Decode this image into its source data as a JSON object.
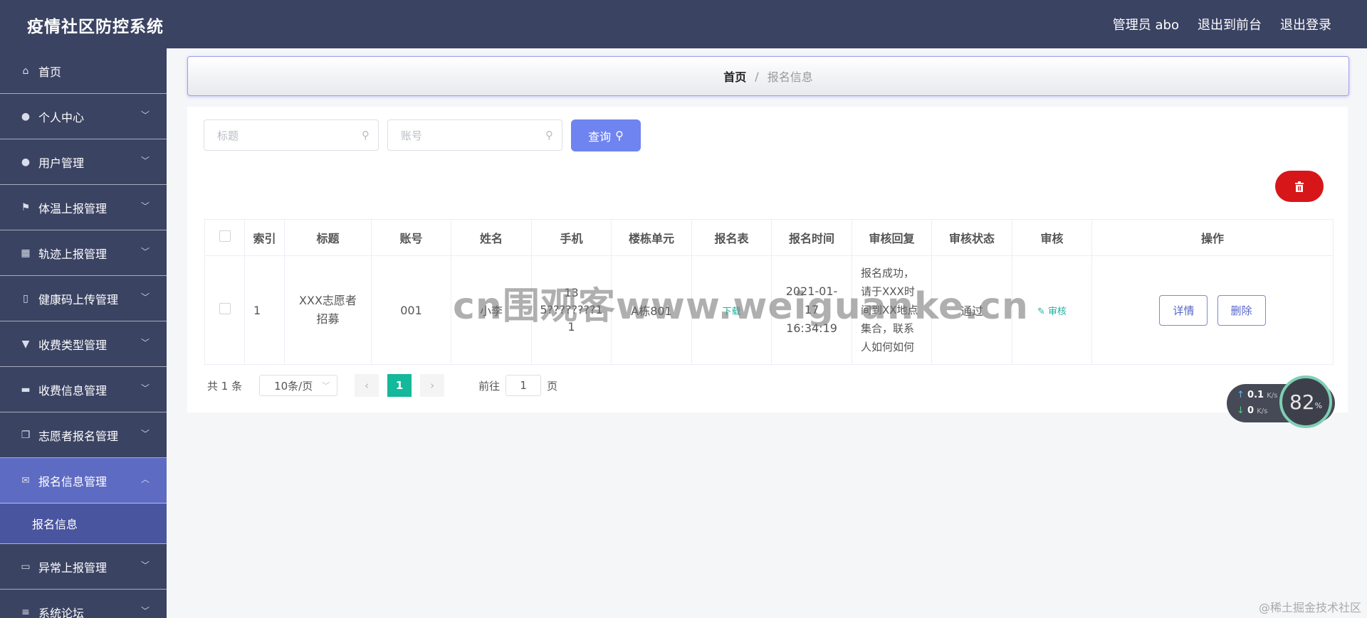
{
  "app": {
    "title": "疫情社区防控系统",
    "top_links": [
      "管理员 abo",
      "退出到前台",
      "退出登录"
    ]
  },
  "sidebar": {
    "items": [
      {
        "label": "首页",
        "icon": "home-icon",
        "glyph": "⌂",
        "has_children": false
      },
      {
        "label": "个人中心",
        "icon": "user-icon",
        "glyph": "●",
        "has_children": true
      },
      {
        "label": "用户管理",
        "icon": "user-icon",
        "glyph": "●",
        "has_children": true
      },
      {
        "label": "体温上报管理",
        "icon": "flag-icon",
        "glyph": "⚑",
        "has_children": true
      },
      {
        "label": "轨迹上报管理",
        "icon": "calendar-icon",
        "glyph": "▦",
        "has_children": true
      },
      {
        "label": "健康码上传管理",
        "icon": "phone-icon",
        "glyph": "▯",
        "has_children": true
      },
      {
        "label": "收费类型管理",
        "icon": "pin-icon",
        "glyph": "▼",
        "has_children": true
      },
      {
        "label": "收费信息管理",
        "icon": "message-icon",
        "glyph": "▬",
        "has_children": true
      },
      {
        "label": "志愿者报名管理",
        "icon": "copy-icon",
        "glyph": "❐",
        "has_children": true
      },
      {
        "label": "报名信息管理",
        "icon": "mail-icon",
        "glyph": "✉",
        "has_children": true,
        "active": true
      },
      {
        "label": "异常上报管理",
        "icon": "card-icon",
        "glyph": "▭",
        "has_children": true
      },
      {
        "label": "系统论坛",
        "icon": "list-icon",
        "glyph": "≡",
        "has_children": true
      }
    ],
    "active_sub": "报名信息"
  },
  "breadcrumb": {
    "home": "首页",
    "separator": "/",
    "current": "报名信息"
  },
  "search": {
    "title_placeholder": "标题",
    "account_placeholder": "账号",
    "query_label": "查询"
  },
  "table": {
    "columns": [
      "索引",
      "标题",
      "账号",
      "姓名",
      "手机",
      "楼栋单元",
      "报名表",
      "报名时间",
      "审核回复",
      "审核状态",
      "审核",
      "操作"
    ],
    "rows": [
      {
        "index": "1",
        "title": "XXX志愿者招募",
        "account": "001",
        "name": "小李",
        "phone": "135????????11",
        "building": "A栋801",
        "form_link": "下载",
        "time": "2021-01-17 16:34:19",
        "reply": "报名成功，请于XXX时间到XX地点集合，联系人如何如何",
        "status": "通过",
        "audit_link": "审核",
        "actions": [
          "详情",
          "删除"
        ]
      }
    ]
  },
  "pagination": {
    "total": "共 1 条",
    "page_size": "10条/页",
    "current_page": "1",
    "goto_prefix": "前往",
    "goto_value": "1",
    "goto_suffix": "页"
  },
  "speed_widget": {
    "up": "0.1",
    "down": "0",
    "unit": "K/s",
    "percent": "82",
    "percent_sign": "%"
  },
  "watermark": "cn围观客www.weiguanke.cn",
  "credit": "@稀土掘金技术社区",
  "colors": {
    "nav_bg": "#3b4363",
    "active_bg": "#5e6bc3",
    "accent": "#6f84f0",
    "danger": "#d7161a",
    "page_current": "#14b89a"
  }
}
